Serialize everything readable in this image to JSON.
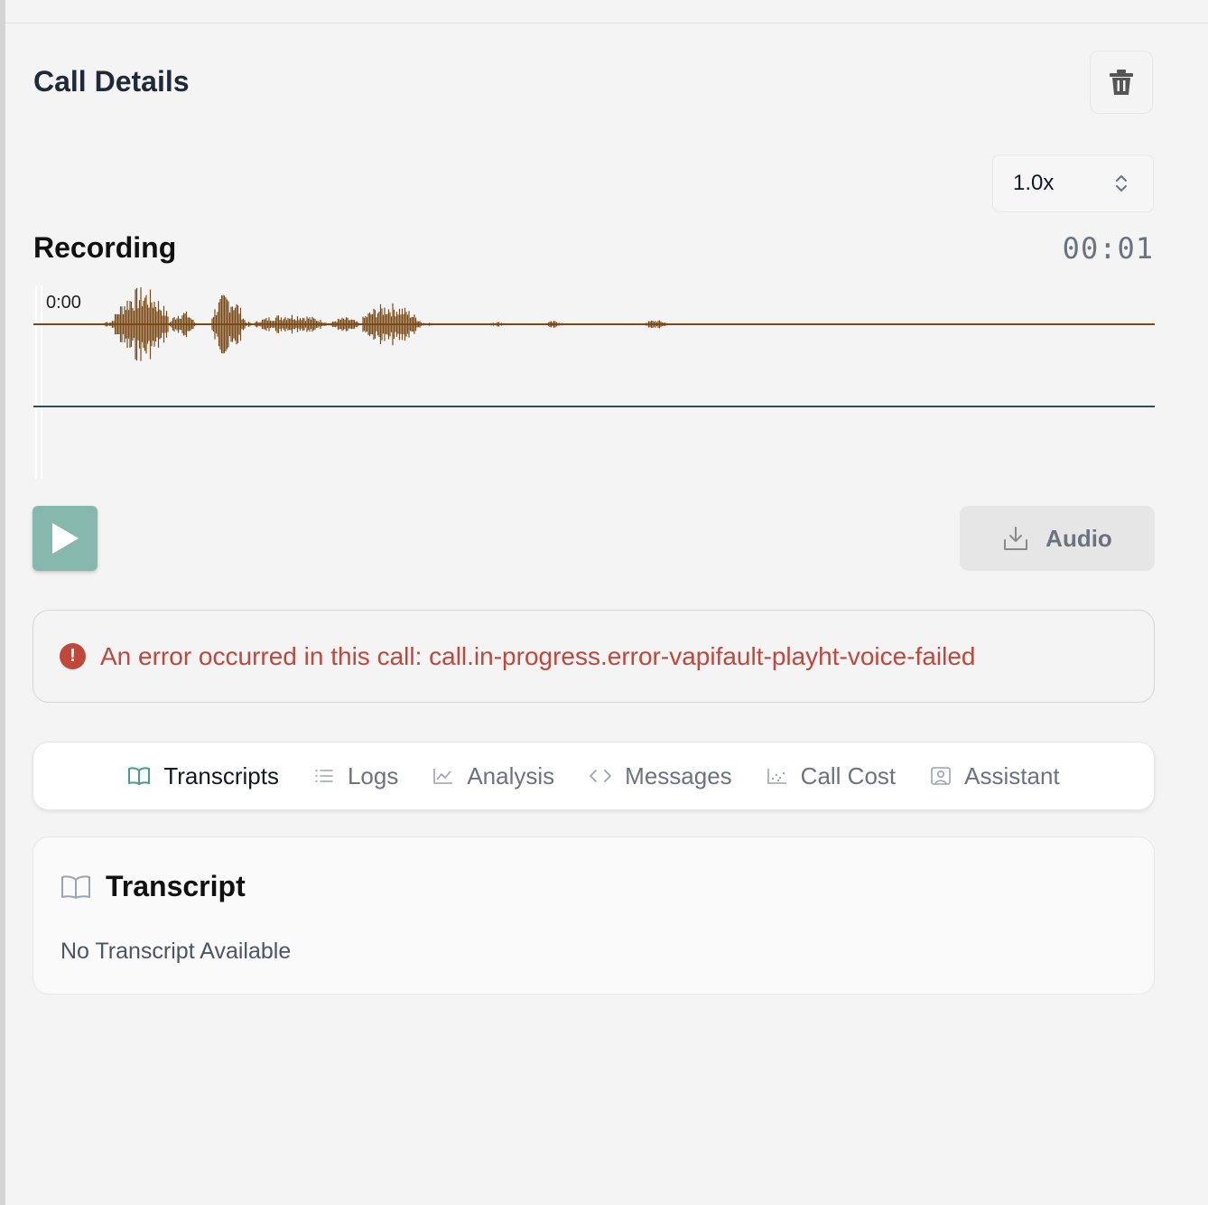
{
  "page": {
    "title": "Call Details"
  },
  "toolbar": {
    "delete_icon": "trash-icon"
  },
  "playback": {
    "speed": "1.0x",
    "section_title": "Recording",
    "elapsed": "00:01",
    "waveform_start_label": "0:00",
    "waveform_color": "#7a4a16",
    "play_button_color": "#86b8ae"
  },
  "download": {
    "label": "Audio",
    "icon": "download-icon"
  },
  "error": {
    "message": "An error occurred in this call: call.in-progress.error-vapifault-playht-voice-failed",
    "color": "#c0473c"
  },
  "tabs": [
    {
      "label": "Transcripts",
      "icon": "book-open-icon",
      "active": true
    },
    {
      "label": "Logs",
      "icon": "list-icon",
      "active": false
    },
    {
      "label": "Analysis",
      "icon": "line-chart-icon",
      "active": false
    },
    {
      "label": "Messages",
      "icon": "code-icon",
      "active": false
    },
    {
      "label": "Call Cost",
      "icon": "scatter-chart-icon",
      "active": false
    },
    {
      "label": "Assistant",
      "icon": "user-square-icon",
      "active": false
    }
  ],
  "transcript": {
    "title": "Transcript",
    "empty_text": "No Transcript Available"
  }
}
